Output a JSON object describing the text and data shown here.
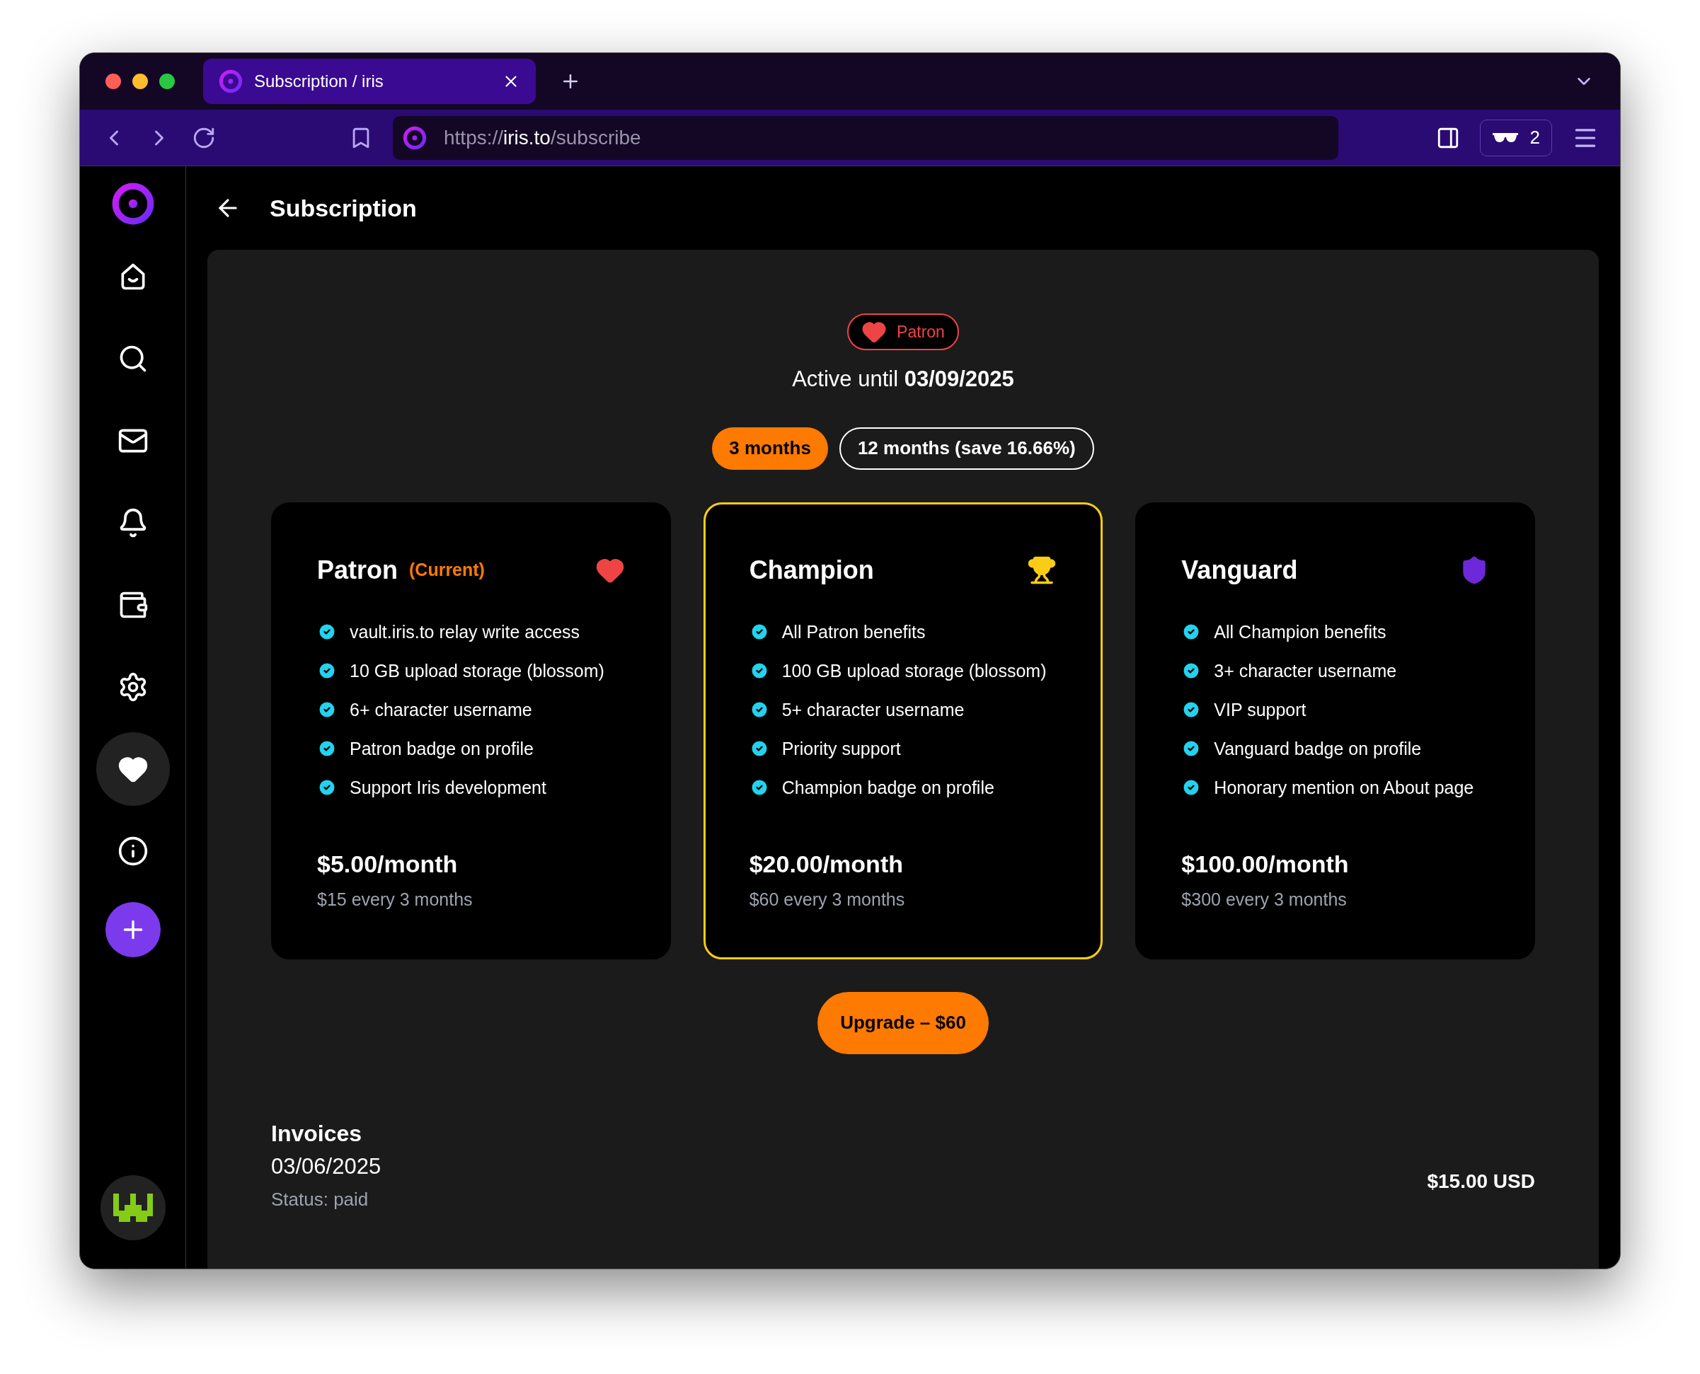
{
  "browser": {
    "tab": {
      "title": "Subscription / iris"
    },
    "url": {
      "scheme": "https://",
      "host": "iris.to",
      "path": "/subscribe"
    },
    "extension_count": "2"
  },
  "sidebar": {
    "items": [
      {
        "selected": false
      },
      {
        "selected": false
      },
      {
        "selected": false
      },
      {
        "selected": false
      },
      {
        "selected": false
      },
      {
        "selected": false
      },
      {
        "selected": true
      },
      {
        "selected": false
      }
    ]
  },
  "page": {
    "title": "Subscription"
  },
  "status": {
    "badge": "Patron",
    "active": "Active until **03/09/2025**"
  },
  "periods": [
    {
      "label": "3 months",
      "selected": true
    },
    {
      "label": "12 months (save 16.66%)",
      "selected": false
    }
  ],
  "plans": [
    {
      "kind": "heart",
      "name": "Patron",
      "current_label": "(Current)",
      "selected": false,
      "features": [
        "vault.iris.to relay write access",
        "10 GB upload storage (blossom)",
        "6+ character username",
        "Patron badge on profile",
        "Support Iris development"
      ],
      "price": "$5.00/month",
      "billing": "$15 every 3 months"
    },
    {
      "kind": "trophy",
      "name": "Champion",
      "selected": true,
      "features": [
        "All Patron benefits",
        "100 GB upload storage (blossom)",
        "5+ character username",
        "Priority support",
        "Champion badge on profile"
      ],
      "price": "$20.00/month",
      "billing": "$60 every 3 months"
    },
    {
      "kind": "shield",
      "name": "Vanguard",
      "selected": false,
      "features": [
        "All Champion benefits",
        "3+ character username",
        "VIP support",
        "Vanguard badge on profile",
        "Honorary mention on About page"
      ],
      "price": "$100.00/month",
      "billing": "$300 every 3 months"
    }
  ],
  "upgrade_button": "Upgrade – $60",
  "invoices": {
    "title": "Invoices",
    "items": [
      {
        "date": "03/06/2025",
        "status": "Status: paid",
        "amount": "$15.00 USD"
      }
    ]
  }
}
